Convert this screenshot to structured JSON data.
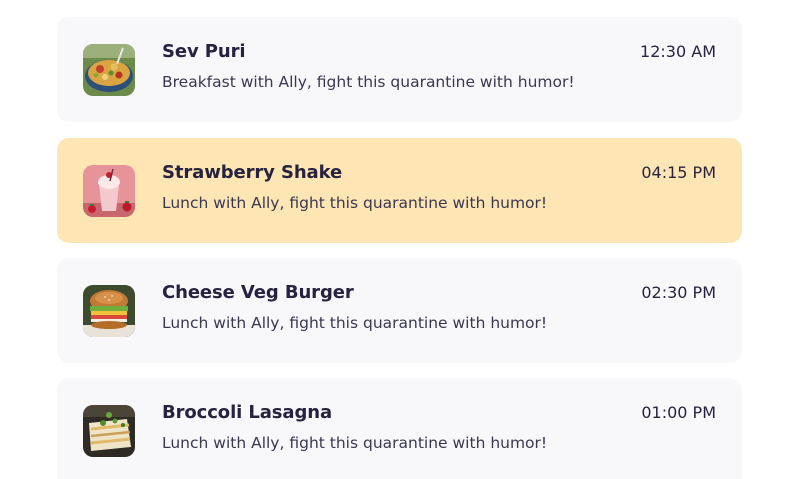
{
  "meals": [
    {
      "title": "Sev Puri",
      "subtitle": "Breakfast with Ally, fight this quarantine with humor!",
      "time": "12:30 AM",
      "selected": false,
      "icon": "sev-puri-photo"
    },
    {
      "title": "Strawberry Shake",
      "subtitle": "Lunch with Ally, fight this quarantine with humor!",
      "time": "04:15 PM",
      "selected": true,
      "icon": "strawberry-shake-photo"
    },
    {
      "title": "Cheese Veg Burger",
      "subtitle": "Lunch with Ally, fight this quarantine with humor!",
      "time": "02:30 PM",
      "selected": false,
      "icon": "burger-photo"
    },
    {
      "title": "Broccoli Lasagna",
      "subtitle": "Lunch with Ally, fight this quarantine with humor!",
      "time": "01:00 PM",
      "selected": false,
      "icon": "lasagna-photo"
    }
  ],
  "colors": {
    "card_background": "#f8f8fb",
    "selected_background": "#fde5b4",
    "text_primary": "#26223f"
  }
}
